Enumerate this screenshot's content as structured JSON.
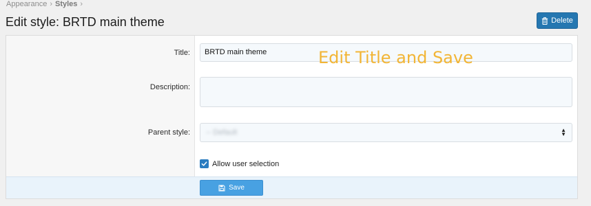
{
  "breadcrumb": {
    "items": [
      "Appearance",
      "Styles"
    ],
    "separator": "›"
  },
  "page": {
    "title": "Edit style: BRTD main theme"
  },
  "toolbar": {
    "delete_label": "Delete",
    "delete_icon": "trash-icon"
  },
  "form": {
    "title_label": "Title:",
    "title_value": "BRTD main theme",
    "description_label": "Description:",
    "description_value": "",
    "parent_label": "Parent style:",
    "parent_value": "-- Default",
    "allow_user_selection_label": "Allow user selection",
    "allow_user_selection_checked": true,
    "save_label": "Save",
    "save_icon": "floppy-disk-icon"
  },
  "annotation": {
    "text": "Edit Title and Save",
    "color": "#f2b535"
  },
  "colors": {
    "accent": "#2577b1",
    "save": "#48a1e2"
  }
}
